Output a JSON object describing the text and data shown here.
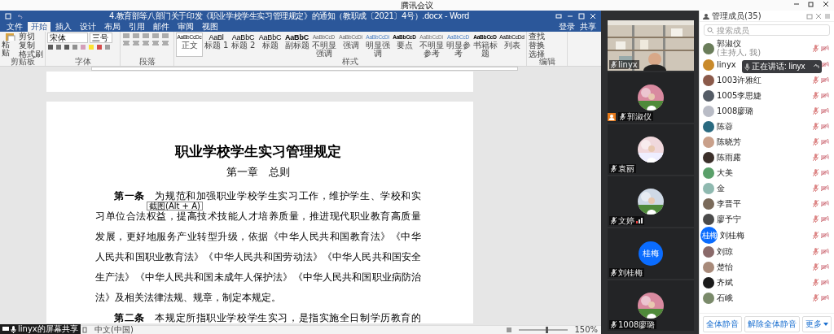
{
  "meeting": {
    "title": "腾讯会议"
  },
  "word": {
    "title": "4.教育部等八部门关于印发《职业学校学生实习管理规定》的通知（教职成〔2021〕4号）.docx - Word",
    "tabs": [
      {
        "label": "文件",
        "selected": false
      },
      {
        "label": "开始",
        "selected": true
      },
      {
        "label": "插入",
        "selected": false
      },
      {
        "label": "设计",
        "selected": false
      },
      {
        "label": "布局",
        "selected": false
      },
      {
        "label": "引用",
        "selected": false
      },
      {
        "label": "邮件",
        "selected": false
      },
      {
        "label": "审阅",
        "selected": false
      },
      {
        "label": "视图",
        "selected": false
      }
    ],
    "account": "登录",
    "share": "共享",
    "clipboard": {
      "paste": "粘贴",
      "items": [
        "剪切",
        "复制",
        "格式刷"
      ]
    },
    "font": {
      "name": "宋体",
      "size": "三号"
    },
    "styles": [
      {
        "sample": "AaBbCcDc",
        "label": "正文",
        "selected": true
      },
      {
        "sample": "AaBl",
        "label": "标题 1",
        "selected": false
      },
      {
        "sample": "AaBbC",
        "label": "标题 2",
        "selected": false
      },
      {
        "sample": "AaBbC",
        "label": "标题",
        "selected": false
      },
      {
        "sample": "AaBbC",
        "label": "副标题",
        "selected": false
      },
      {
        "sample": "AaBbCcD",
        "label": "不明显强调",
        "selected": false
      },
      {
        "sample": "AaBbCcDi",
        "label": "强调",
        "selected": false
      },
      {
        "sample": "AaBbCcDi",
        "label": "明显强调",
        "selected": false
      },
      {
        "sample": "AaBbCcD",
        "label": "要点",
        "selected": false
      },
      {
        "sample": "AaBbCcDi",
        "label": "不明显参考",
        "selected": false
      },
      {
        "sample": "AaBbCcD",
        "label": "明显参考",
        "selected": false
      },
      {
        "sample": "AaBbCcD",
        "label": "书籍标题",
        "selected": false
      },
      {
        "sample": "AaBbCcDd",
        "label": "列表",
        "selected": false
      }
    ],
    "editing": [
      "查找",
      "替换",
      "选择"
    ],
    "groups": [
      "剪贴板",
      "字体",
      "段落",
      "样式",
      "编辑"
    ],
    "document": {
      "title": "职业学校学生实习管理规定",
      "chapter": "第一章　总则",
      "paragraphs": [
        {
          "lines": [
            "**第一条**　为规范和加强职业学校学生实习工作，维护学生、学校和实",
            "习单位合法权益，提高技术技能人才培养质量，推进现代职业教育高质量",
            "发展，更好地服务产业转型升级，依据《中华人民共和国教育法》《中华",
            "人民共和国职业教育法》《中华人民共和国劳动法》《中华人民共和国安全",
            "生产法》《中华人民共和国未成年人保护法》《中华人民共和国职业病防治",
            "法》及相关法律法规、规章，制定本规定。"
          ]
        },
        {
          "lines": [
            "**第二条**　本规定所指职业学校学生实习，是指实施全日制学历教育的"
          ]
        }
      ]
    },
    "tooltip": "截图(Alt + A)",
    "language": "中文(中国)",
    "zoom": "150%",
    "zoom_level": {
      "level": 0.55
    }
  },
  "share_badge": "linyx的屏幕共享",
  "videos": [
    {
      "name": "linyx",
      "kind": "camera",
      "host": false,
      "poor_network": false
    },
    {
      "name": "郭淑仪",
      "host": true,
      "poor_network": false
    },
    {
      "name": "袁丽",
      "host": false,
      "poor_network": false
    },
    {
      "name": "文婷",
      "host": false,
      "poor_network": true
    },
    {
      "name": "刘桂梅",
      "kind": "initials",
      "initials": "桂梅",
      "host": false,
      "poor_network": false
    },
    {
      "name": "1008廖璐",
      "host": false,
      "poor_network": false
    }
  ],
  "members_panel": {
    "title": "管理成员(35)",
    "search_placeholder": "搜索成员",
    "speaking": "正在讲话: linyx",
    "members": [
      {
        "name": "郭淑仪",
        "note": "(主持人, 我)",
        "mic_on": false,
        "camera_on": false
      },
      {
        "name": "linyx",
        "camera_on": false
      },
      {
        "name": "1003许雅红",
        "mic_on": false,
        "camera_on": false
      },
      {
        "name": "1005李思婕",
        "mic_on": false,
        "camera_on": false
      },
      {
        "name": "1008廖璐",
        "mic_on": false,
        "camera_on": false
      },
      {
        "name": "陈蓉",
        "mic_on": false,
        "camera_on": false
      },
      {
        "name": "陈晓芳",
        "mic_on": false,
        "camera_on": false
      },
      {
        "name": "陈雨露",
        "mic_on": false,
        "camera_on": false
      },
      {
        "name": "大美",
        "mic_on": false,
        "camera_on": false
      },
      {
        "name": "金",
        "mic_on": false,
        "camera_on": false
      },
      {
        "name": "李晋平",
        "mic_on": false,
        "camera_on": false
      },
      {
        "name": "廖予宁",
        "mic_on": false,
        "camera_on": false
      },
      {
        "name": "刘桂梅",
        "initials": "桂梅",
        "mic_on": false,
        "camera_on": false
      },
      {
        "name": "刘琼",
        "mic_on": false,
        "camera_on": false
      },
      {
        "name": "楚怡",
        "mic_on": false,
        "camera_on": false
      },
      {
        "name": "齐斌",
        "mic_on": false,
        "camera_on": false
      },
      {
        "name": "石峨",
        "mic_on": false,
        "camera_on": false
      }
    ],
    "buttons": [
      "全体静音",
      "解除全体静音",
      "更多"
    ]
  }
}
